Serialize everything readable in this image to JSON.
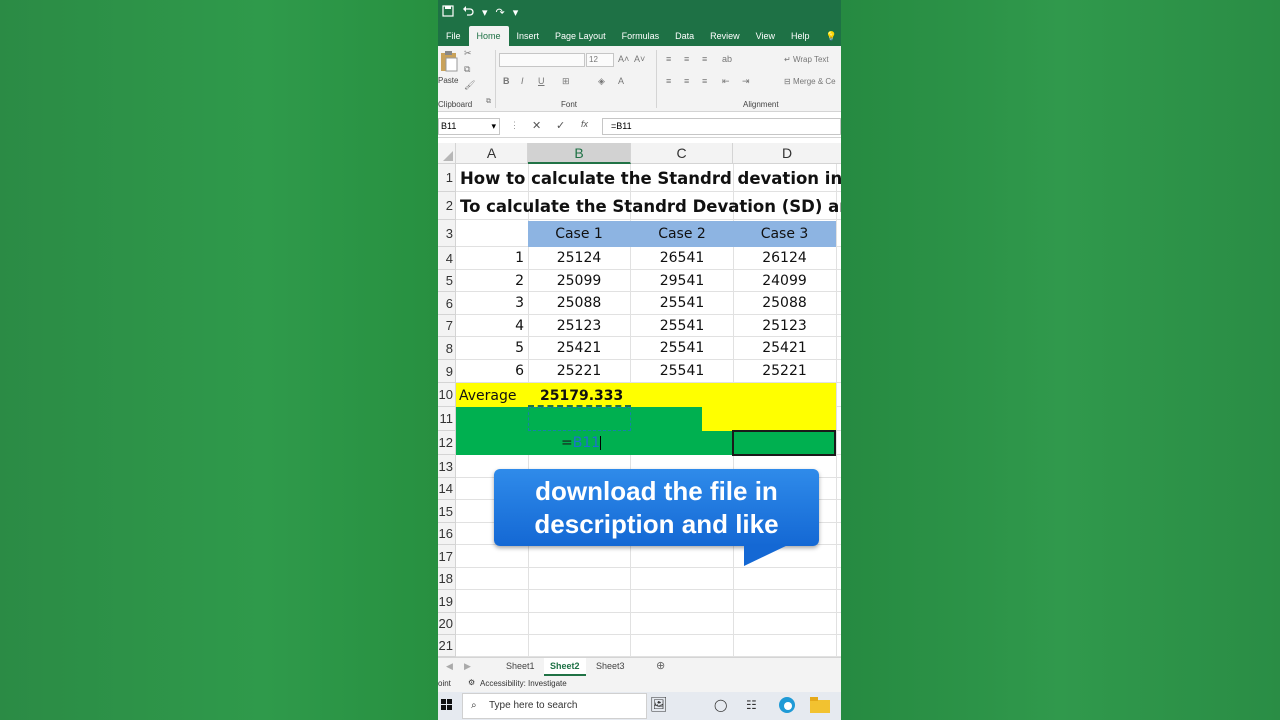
{
  "titlebar": {
    "save_icon": "save-icon",
    "undo_icon": "undo-icon"
  },
  "ribbon_tabs": [
    "File",
    "Home",
    "Insert",
    "Page Layout",
    "Formulas",
    "Data",
    "Review",
    "View",
    "Help"
  ],
  "ribbon": {
    "paste_label": "Paste",
    "clipboard_label": "Clipboard",
    "font_label": "Font",
    "alignment_label": "Alignment",
    "font_size": "12",
    "wrap_text": "Wrap Text",
    "merge": "Merge & Ce",
    "bold": "B",
    "italic": "I",
    "underline": "U"
  },
  "formula_bar": {
    "name_box": "B11",
    "formula": "=B11",
    "fx": "fx"
  },
  "columns": [
    "A",
    "B",
    "C",
    "D"
  ],
  "rows": [
    "1",
    "2",
    "3",
    "4",
    "5",
    "6",
    "7",
    "8",
    "9",
    "10",
    "11",
    "12",
    "13",
    "14",
    "15",
    "16",
    "17",
    "18",
    "19",
    "20",
    "21"
  ],
  "sheet": {
    "title1": "How to calculate the Standrd devation in Ex",
    "title2": "To calculate the Standrd Devation  (SD) and",
    "headers": [
      "Case 1",
      "Case 2",
      "Case 3"
    ],
    "data_rows": [
      [
        "1",
        "25124",
        "26541",
        "26124"
      ],
      [
        "2",
        "25099",
        "29541",
        "24099"
      ],
      [
        "3",
        "25088",
        "25541",
        "25088"
      ],
      [
        "4",
        "25123",
        "25541",
        "25123"
      ],
      [
        "5",
        "25421",
        "25541",
        "25421"
      ],
      [
        "6",
        "25221",
        "25541",
        "25221"
      ]
    ],
    "average_label": "Average",
    "average_value": "25179.333",
    "editing_formula_eq": "=",
    "editing_formula_ref": "B11"
  },
  "callout": {
    "line1": "download the file in",
    "line2": "description  and like"
  },
  "sheet_tabs": [
    "Sheet1",
    "Sheet2",
    "Sheet3"
  ],
  "active_sheet": "Sheet2",
  "status": {
    "mode": "oint",
    "accessibility": "Accessibility: Investigate"
  },
  "taskbar": {
    "search_placeholder": "Type here to search"
  },
  "colors": {
    "excel_green": "#1e7145",
    "header_blue": "#8db4e2",
    "highlight_yellow": "#ffff00",
    "highlight_green": "#00b050"
  }
}
